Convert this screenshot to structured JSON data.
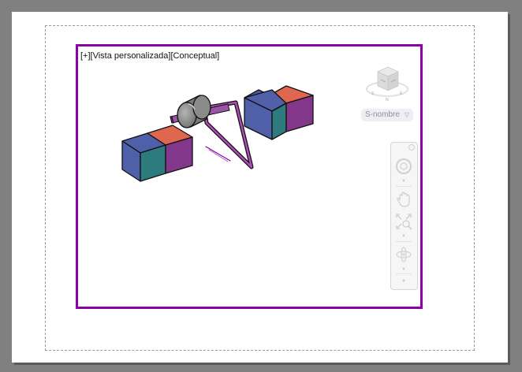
{
  "viewport": {
    "controls": "[+]",
    "view": "[Vista personalizada]",
    "style": "[Conceptual]"
  },
  "viewcube": {
    "icon": "viewcube-icon"
  },
  "ucs_menu": {
    "label": "S-nombre"
  },
  "navigation_bar": {
    "tools": [
      "steering-wheel-icon",
      "pan-icon",
      "zoom-extents-icon",
      "orbit-icon"
    ]
  },
  "colors": {
    "viewport_border": "#8b00a8",
    "cube_blue": "#4f5fa8",
    "cube_teal": "#2e7b7e",
    "cube_red": "#e0674f",
    "cube_purple": "#83378a",
    "cylinder": "#8a8a8a",
    "frame_magenta": "#b04db8"
  }
}
